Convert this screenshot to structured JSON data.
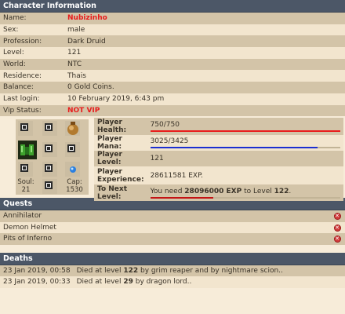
{
  "info": {
    "title": "Character Information",
    "rows": [
      {
        "label": "Name:",
        "value": "Nubizinho"
      },
      {
        "label": "Sex:",
        "value": "male"
      },
      {
        "label": "Profession:",
        "value": "Dark Druid"
      },
      {
        "label": "Level:",
        "value": "121"
      },
      {
        "label": "World:",
        "value": "NTC"
      },
      {
        "label": "Residence:",
        "value": "Thais"
      },
      {
        "label": "Balance:",
        "value": "0 Gold Coins."
      },
      {
        "label": "Last login:",
        "value": "10 February 2019, 6:43 pm"
      },
      {
        "label": "Vip Status:",
        "value": "NOT VIP"
      }
    ]
  },
  "equipment": {
    "soul_label": "Soul:",
    "soul_value": "21",
    "cap_label": "Cap:",
    "cap_value": "1530"
  },
  "stats": {
    "health_label": "Player Health:",
    "health_value": "750/750",
    "health_fraction": 1.0,
    "mana_label": "Player Mana:",
    "mana_value": "3025/3425",
    "mana_fraction": 0.88,
    "level_label": "Player Level:",
    "level_value": "121",
    "exp_label": "Player Experience:",
    "exp_value": "28611581 EXP.",
    "next_label": "To Next Level:",
    "next_prefix": "You need ",
    "next_amount": "28096000 EXP",
    "next_mid": " to Level ",
    "next_level": "122",
    "next_suffix": ".",
    "next_fraction": 0.33,
    "colors": {
      "health": "#e81c1c",
      "mana": "#1c2fd1",
      "next": "#c41414"
    }
  },
  "quests": {
    "title": "Quests",
    "items": [
      {
        "name": "Annihilator",
        "status_icon": "x-circle-icon"
      },
      {
        "name": "Demon Helmet",
        "status_icon": "x-circle-icon"
      },
      {
        "name": "Pits of Inferno",
        "status_icon": "x-circle-icon"
      }
    ]
  },
  "deaths": {
    "title": "Deaths",
    "items": [
      {
        "date": "23 Jan 2019, 00:58",
        "pre": "Died at level ",
        "level": "122",
        "post": " by grim reaper and by nightmare scion.."
      },
      {
        "date": "23 Jan 2019, 00:33",
        "pre": "Died at level ",
        "level": "29",
        "post": " by dragon lord.."
      }
    ]
  }
}
